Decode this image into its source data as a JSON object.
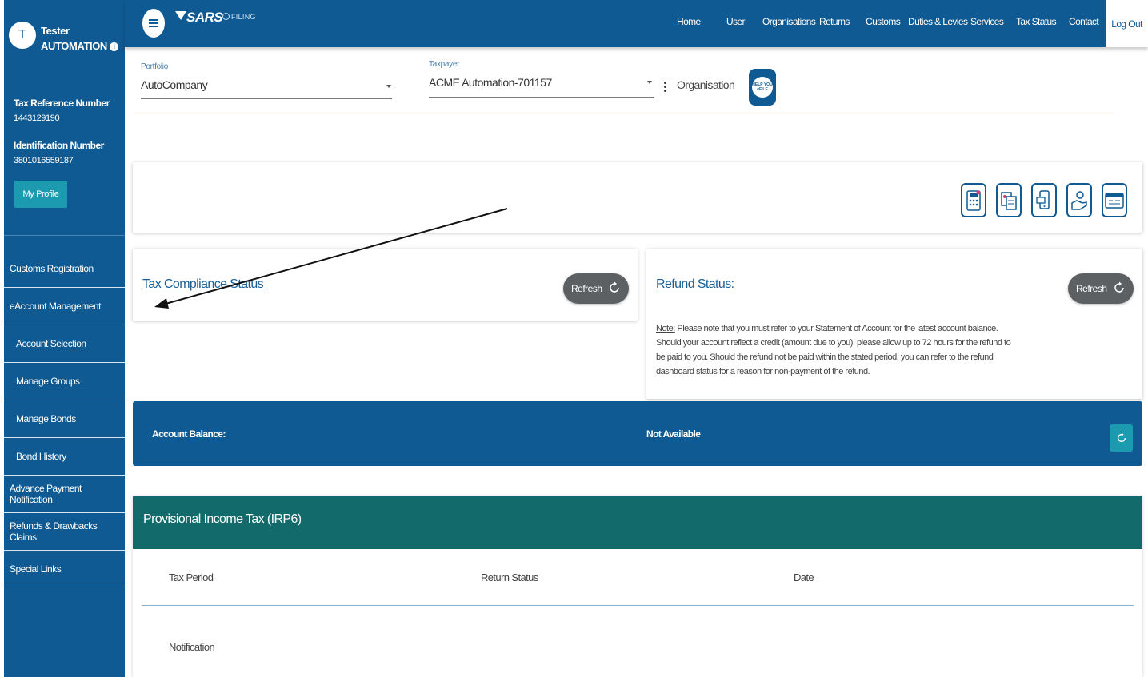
{
  "user": {
    "avatar_initial": "T",
    "first_name": "Tester",
    "last_name": "AUTOMATION",
    "tax_reference_label": "Tax Reference Number",
    "tax_reference_value": "1443129190",
    "identification_label": "Identification Number",
    "identification_value": "3801016559187",
    "my_profile_label": "My Profile"
  },
  "sidebar": {
    "items": [
      {
        "label": "Customs Registration"
      },
      {
        "label": "eAccount Management"
      },
      {
        "label": "Account Selection"
      },
      {
        "label": "Manage Groups"
      },
      {
        "label": "Manage Bonds"
      },
      {
        "label": "Bond History"
      },
      {
        "label": "Advance Payment Notification"
      },
      {
        "label": "Refunds & Drawbacks Claims"
      },
      {
        "label": "Special Links"
      }
    ]
  },
  "header": {
    "logo_text": "SARS",
    "efiling_text": "FILING",
    "nav": [
      "Home",
      "User",
      "Organisations",
      "Returns",
      "Customs",
      "Duties & Levies",
      "Services",
      "Tax Status",
      "Contact"
    ],
    "logout_label": "Log Out"
  },
  "selectors": {
    "portfolio_label": "Portfolio",
    "portfolio_value": "AutoCompany",
    "taxpayer_label": "Taxpayer",
    "taxpayer_value": "ACME Automation-701157",
    "organisation_label": "Organisation",
    "help_text": "HELP YOU eFILE"
  },
  "tax_compliance": {
    "title": "Tax Compliance Status",
    "refresh_label": "Refresh"
  },
  "refund": {
    "title": "Refund Status:",
    "refresh_label": "Refresh",
    "note_label": "Note:",
    "note_text": " Please note that you must refer to your Statement of Account for the latest account balance. Should your account reflect a credit (amount due to you), please allow up to 72 hours for the refund to be paid to you. Should the refund not be paid within the stated period, you can refer to the refund dashboard status for a reason for non-payment of the refund."
  },
  "account_balance": {
    "label": "Account Balance:",
    "value": "Not Available"
  },
  "irp6": {
    "title": "Provisional Income Tax (IRP6)",
    "columns": [
      "Tax Period",
      "Return Status",
      "Date"
    ],
    "notification_label": "Notification"
  },
  "colors": {
    "primary": "#0f5a92",
    "teal": "#136a6b",
    "accent": "#1c9bb0",
    "refresh_button": "#5d6063"
  }
}
